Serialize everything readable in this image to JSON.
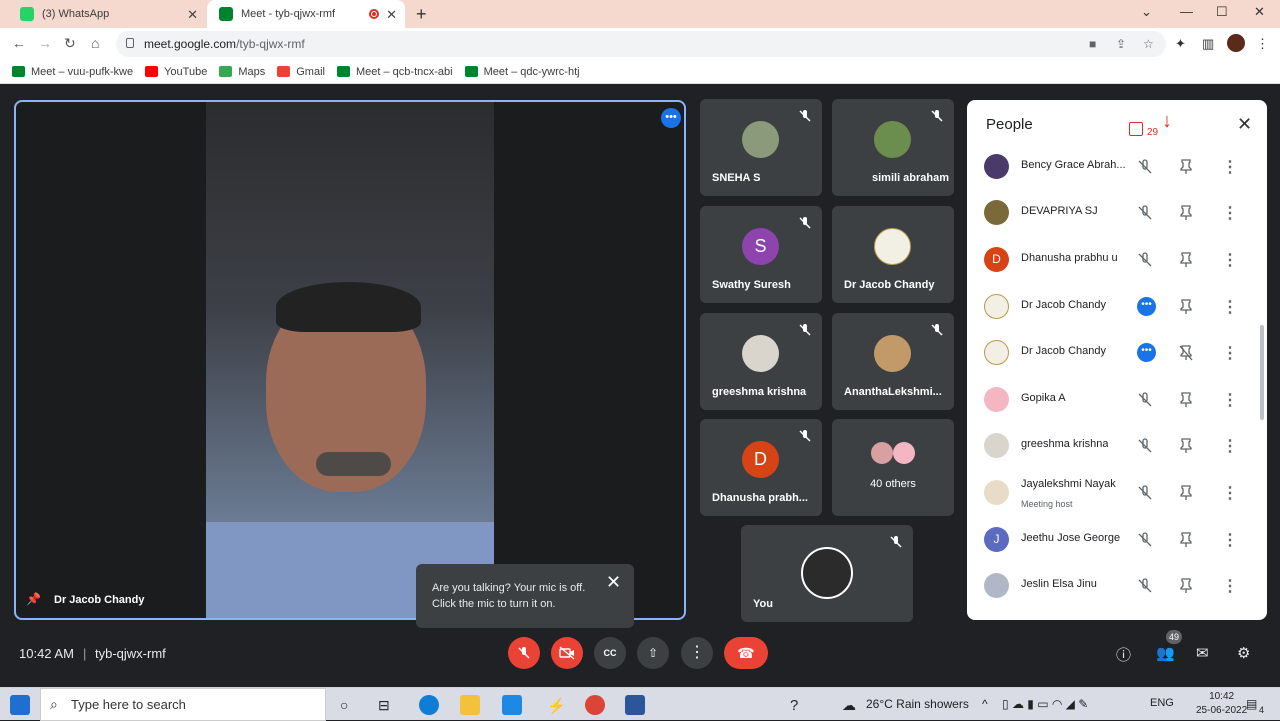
{
  "browser": {
    "tabs": [
      {
        "label": "(3) WhatsApp",
        "favicon_color": "#25d366",
        "badge": "3"
      },
      {
        "label": "Meet - tyb-qjwx-rmf",
        "favicon_color": "#00832d"
      }
    ],
    "url_domain": "meet.google.com",
    "url_path": "/tyb-qjwx-rmf",
    "bookmarks": [
      {
        "label": "Meet – vuu-pufk-kwe",
        "icon_color": "#00832d"
      },
      {
        "label": "YouTube",
        "icon_color": "#ff0000"
      },
      {
        "label": "Maps",
        "icon_color": "#34a853"
      },
      {
        "label": "Gmail",
        "icon_color": "#ea4335"
      },
      {
        "label": "Meet – qcb-tncx-abi",
        "icon_color": "#00832d"
      },
      {
        "label": "Meet – qdc-ywrc-htj",
        "icon_color": "#00832d"
      }
    ]
  },
  "main_tile": {
    "name": "Dr Jacob Chandy"
  },
  "tiles": [
    {
      "name": "SNEHA S",
      "avatar_color": "#8a9a7a",
      "initial": ""
    },
    {
      "name": "simili abraham",
      "avatar_color": "#6b8e4e",
      "initial": ""
    },
    {
      "name": "Swathy Suresh",
      "avatar_color": "#8e44ad",
      "initial": "S"
    },
    {
      "name": "Dr Jacob Chandy",
      "avatar_color": "#f2efe4",
      "initial": ""
    },
    {
      "name": "greeshma krishna",
      "avatar_color": "#d9d4cc",
      "initial": ""
    },
    {
      "name": "AnanthaLekshmi...",
      "avatar_color": "#c29a6a",
      "initial": ""
    },
    {
      "name": "Dhanusha prabh...",
      "avatar_color": "#d84315",
      "initial": "D"
    },
    {
      "name": "40 others",
      "avatar_color": "#e6a4a4",
      "initial": ""
    },
    {
      "name": "You",
      "avatar_color": "#2b2b2b",
      "initial": ""
    }
  ],
  "people_panel": {
    "title": "People",
    "badge_count": "29",
    "participants": [
      {
        "name": "Bency Grace Abrah...",
        "avatar_color": "#4a3a6a",
        "initial": "",
        "sub": "",
        "blue": false
      },
      {
        "name": "DEVAPRIYA SJ",
        "avatar_color": "#7a6a3a",
        "initial": "",
        "sub": "",
        "blue": false
      },
      {
        "name": "Dhanusha prabhu u",
        "avatar_color": "#d84315",
        "initial": "D",
        "sub": "",
        "blue": false
      },
      {
        "name": "Dr Jacob Chandy",
        "avatar_color": "#f2efe4",
        "initial": "",
        "sub": "",
        "blue": true
      },
      {
        "name": "Dr Jacob Chandy",
        "avatar_color": "#f2efe4",
        "initial": "",
        "sub": "",
        "blue": true
      },
      {
        "name": "Gopika A",
        "avatar_color": "#f4b6c2",
        "initial": "",
        "sub": "",
        "blue": false
      },
      {
        "name": "greeshma krishna",
        "avatar_color": "#d9d4cc",
        "initial": "",
        "sub": "",
        "blue": false
      },
      {
        "name": "Jayalekshmi Nayak",
        "avatar_color": "#e8dcc8",
        "initial": "",
        "sub": "Meeting host",
        "blue": false
      },
      {
        "name": "Jeethu Jose George",
        "avatar_color": "#5c6bc0",
        "initial": "J",
        "sub": "",
        "blue": false
      },
      {
        "name": "Jeslin Elsa Jinu",
        "avatar_color": "#b0b8c8",
        "initial": "",
        "sub": "",
        "blue": false
      }
    ]
  },
  "popup": {
    "text": "Are you talking? Your mic is off. Click the mic to turn it on."
  },
  "bottom_bar": {
    "time": "10:42 AM",
    "meeting_code": "tyb-qjwx-rmf",
    "participant_count": "49"
  },
  "taskbar": {
    "search_placeholder": "Type here to search",
    "weather": "26°C  Rain showers",
    "lang": "ENG",
    "clock_time": "10:42",
    "clock_date": "25-06-2022",
    "notification_count": "4"
  }
}
